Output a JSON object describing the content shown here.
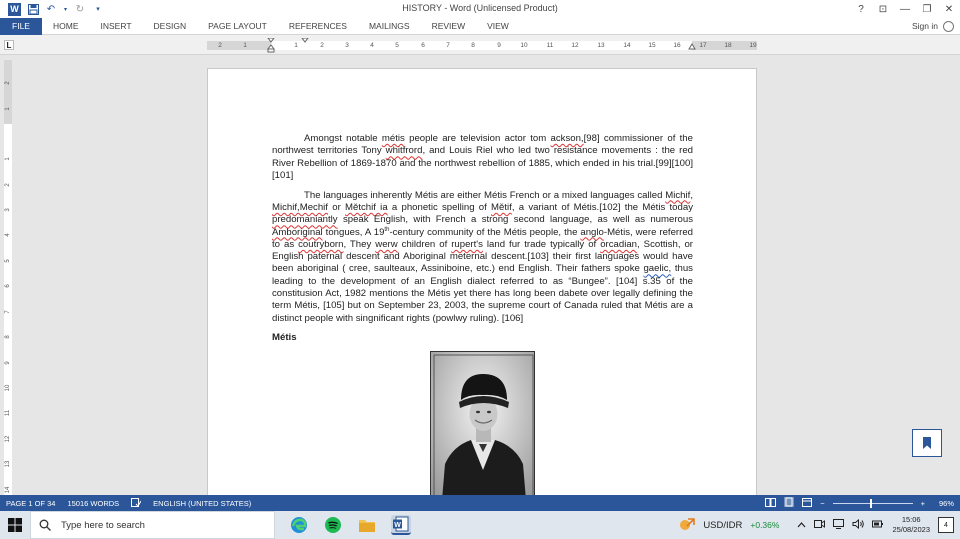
{
  "window": {
    "title": "HISTORY - Word (Unlicensed Product)",
    "controls": {
      "help": "?",
      "restore_ribbon": "⊡",
      "minimize": "—",
      "restore": "❐",
      "close": "✕"
    }
  },
  "ribbon": {
    "tabs": [
      {
        "label": "FILE"
      },
      {
        "label": "HOME"
      },
      {
        "label": "INSERT"
      },
      {
        "label": "DESIGN"
      },
      {
        "label": "PAGE LAYOUT"
      },
      {
        "label": "REFERENCES"
      },
      {
        "label": "MAILINGS"
      },
      {
        "label": "REVIEW"
      },
      {
        "label": "VIEW"
      }
    ],
    "sign_in": "Sign in"
  },
  "ruler": {
    "tab_selector": "L",
    "numbers": [
      "2",
      "1",
      "1",
      "2",
      "3",
      "4",
      "5",
      "6",
      "7",
      "8",
      "9",
      "10",
      "11",
      "12",
      "13",
      "14",
      "15",
      "16",
      "17",
      "18",
      "19"
    ]
  },
  "document": {
    "p1": {
      "a": "Amongst notable ",
      "e1": "métis",
      "b": " people are television actor tom ",
      "e2": "ackson,",
      "c": "[98] commissioner of the northwest territories Tony ",
      "e3": "whitfrord",
      "d": ", and Louis Riel who led two resistance movements : the red River Rebellion of 1869-1870 and the northwest rebellion of 1885, which ended in his trial.[99][100][101]"
    },
    "p2": {
      "a": "The languages inherently Métis are either Métis French or a mixed languages called ",
      "e1": "Michif",
      "b": ", ",
      "e2": "Michif,Mechif",
      "c": " or ",
      "e3": "Mětchif ia",
      "d": " a phonetic spelling of ",
      "e4": "Mětif",
      "e": ", a variant of Métis.[102] the Métis today ",
      "e5": "predomaniantly",
      "f": " speak English, with French a strong second language, as well as numerous ",
      "e6": "Amboriginal",
      "g": " tongues, A 19",
      "sup": "th",
      "h": "-century community of the Métis people, the ",
      "e7": "anglo",
      "i": "-Métis, were referred to as ",
      "e8": "coutryborn",
      "j": ", They ",
      "e9": "werw",
      "k": " children of ",
      "e10": "rupert's",
      "l": " land fur trade typically of ",
      "e11": "orcadian",
      "m": ", Scottish, or English paternal descent and Aboriginal meternal descent.[103] their first languages would have been aboriginal ( cree, saulteaux, Assiniboine, etc.) end English. Their fathers spoke ",
      "e12": "gaelic,",
      "n": " thus leading to the development of an English dialect referred to as “Bungee”. [104] s.35 of the constitusion Act, 1982 mentions the Métis yet there has long been dabete over legally defining the term Métis, [105] but on September 23, 2003, the supreme court of Canada ruled that Métis are a distinct people with singnificant rights (powlwy ruling). [106]"
    },
    "heading": "Métis"
  },
  "status_bar": {
    "page": "PAGE 1 OF 34",
    "words": "15016 WORDS",
    "language": "ENGLISH (UNITED STATES)",
    "zoom_minus": "−",
    "zoom_plus": "+",
    "zoom": "96%",
    "zoom_level": 0.96
  },
  "taskbar": {
    "search_placeholder": "Type here to search",
    "ticker": "USD/IDR",
    "ticker_change": "+0.36%",
    "time": "15:06",
    "date": "25/08/2023",
    "notifications": "4"
  },
  "colors": {
    "accent": "#2b579a"
  }
}
